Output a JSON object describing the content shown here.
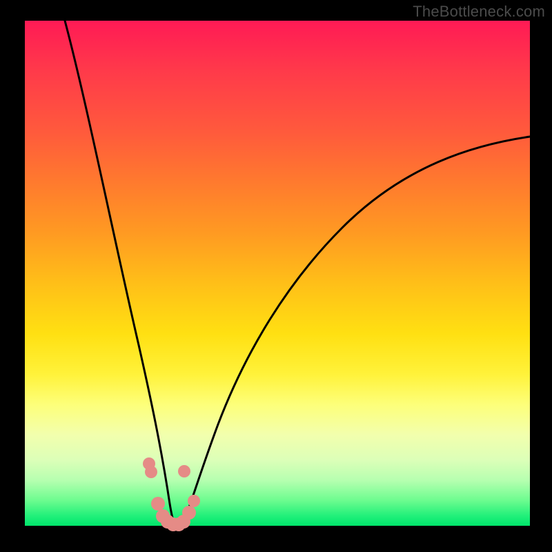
{
  "watermark": "TheBottleneck.com",
  "chart_data": {
    "type": "line",
    "title": "",
    "xlabel": "",
    "ylabel": "",
    "xlim": [
      0,
      100
    ],
    "ylim": [
      0,
      100
    ],
    "grid": false,
    "legend": false,
    "series": [
      {
        "name": "left-branch",
        "x": [
          8,
          10,
          12,
          14,
          16,
          18,
          20,
          22,
          24,
          25,
          26,
          27,
          28,
          29
        ],
        "y": [
          100,
          90,
          79,
          68,
          57,
          46,
          35,
          24,
          13,
          8,
          4,
          1.5,
          0.5,
          0
        ]
      },
      {
        "name": "right-branch",
        "x": [
          29,
          30,
          31,
          32,
          34,
          37,
          41,
          46,
          52,
          60,
          70,
          82,
          95,
          100
        ],
        "y": [
          0,
          0.3,
          1,
          2.5,
          6,
          12,
          20,
          29,
          38,
          48,
          58,
          67,
          74,
          77
        ]
      },
      {
        "name": "valley-dots",
        "x": [
          24.8,
          25.1,
          26.0,
          27.0,
          28.0,
          29.0,
          30.0,
          31.0,
          31.2,
          32.0,
          33.0
        ],
        "y": [
          12,
          10.5,
          4.5,
          1.5,
          0.7,
          0.3,
          0.5,
          1.2,
          10,
          3.0,
          5.5
        ]
      }
    ],
    "background_gradient_stops": [
      {
        "pos": 0.0,
        "color": "#ff1a55"
      },
      {
        "pos": 0.32,
        "color": "#ff7a2e"
      },
      {
        "pos": 0.62,
        "color": "#ffe012"
      },
      {
        "pos": 0.82,
        "color": "#f2ffad"
      },
      {
        "pos": 1.0,
        "color": "#00e56b"
      }
    ]
  }
}
